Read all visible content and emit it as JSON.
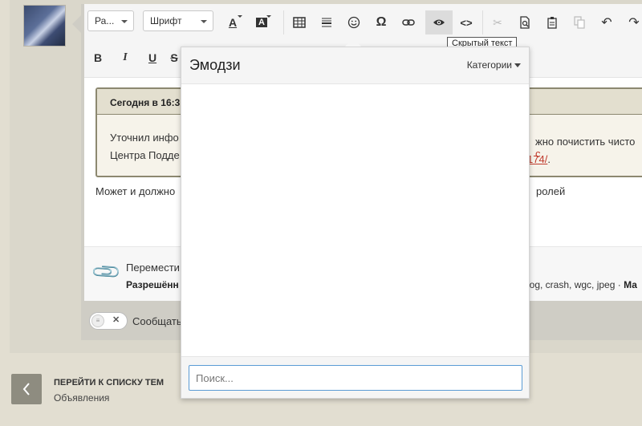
{
  "toolbar": {
    "paragraph_label": "Ра...",
    "font_label": "Шрифт",
    "text_color_glyph": "A",
    "bg_color_glyph": "A",
    "bold_glyph": "B",
    "italic_glyph": "I",
    "underline_glyph": "U",
    "strike_glyph": "S",
    "tooltip_hidden_text": "Скрытый текст",
    "icons": [
      "table-icon",
      "horizontal-rule-icon",
      "emoji-icon",
      "special-chars-icon",
      "link-icon",
      "hidden-text-eye-icon",
      "source-code-icon",
      "cut-icon",
      "find-icon",
      "paste-icon",
      "copy-icon",
      "undo-icon",
      "redo-icon"
    ]
  },
  "quote": {
    "header": "Сегодня в 16:3",
    "line1_start": "Уточнил инфо",
    "line1_end": "жно почистить чисто ",
    "line1_red": "с",
    "line2_start": "Центра Подде",
    "line2_link": "174/",
    "line2_end": "."
  },
  "post": {
    "text_start": "Может и должно",
    "text_end": "ролей"
  },
  "attachments": {
    "line1": "Перемести",
    "line2": "Разрешённ",
    "allowed_tail": "log, crash, wgc, jpeg · ",
    "allowed_tail_bold": "Ма"
  },
  "toggle": {
    "label": "Сообщать"
  },
  "nav": {
    "back_title": "ПЕРЕЙТИ К СПИСКУ ТЕМ",
    "back_subtitle": "Объявления"
  },
  "emoji_panel": {
    "title": "Эмодзи",
    "categories_label": "Категории",
    "search_placeholder": "Поиск..."
  }
}
